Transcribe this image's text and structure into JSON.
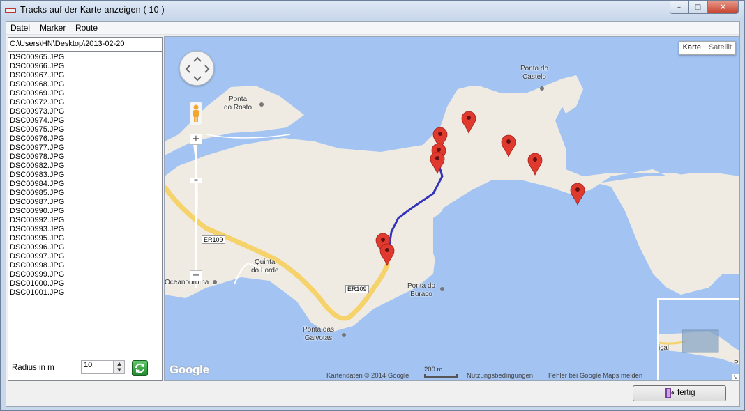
{
  "window": {
    "title": "Tracks auf der Karte anzeigen  ( 10 )",
    "controls": {
      "minimize": "–",
      "maximize": "□",
      "close": "✕"
    }
  },
  "menu": {
    "items": [
      "Datei",
      "Marker",
      "Route"
    ]
  },
  "left_panel": {
    "path": "C:\\Users\\HN\\Desktop\\2013-02-20",
    "files": [
      "DSC00965.JPG",
      "DSC00966.JPG",
      "DSC00967.JPG",
      "DSC00968.JPG",
      "DSC00969.JPG",
      "DSC00972.JPG",
      "DSC00973.JPG",
      "DSC00974.JPG",
      "DSC00975.JPG",
      "DSC00976.JPG",
      "DSC00977.JPG",
      "DSC00978.JPG",
      "DSC00982.JPG",
      "DSC00983.JPG",
      "DSC00984.JPG",
      "DSC00985.JPG",
      "DSC00987.JPG",
      "DSC00990.JPG",
      "DSC00992.JPG",
      "DSC00993.JPG",
      "DSC00995.JPG",
      "DSC00996.JPG",
      "DSC00997.JPG",
      "DSC00998.JPG",
      "DSC00999.JPG",
      "DSC01000.JPG",
      "DSC01001.JPG"
    ],
    "radius_label": "Radius in m",
    "radius_value": "10"
  },
  "map": {
    "type_buttons": {
      "map": "Karte",
      "satellite": "Satellit"
    },
    "labels": {
      "ponta_do_castelo": "Ponta do\nCastelo",
      "ponta_do_rosto": "Ponta\ndo Rosto",
      "quinta_do_lorde": "Quinta\ndo Lorde",
      "oceanodroma": "Oceanodroma",
      "ponta_do_buraco": "Ponta do\nBuraco",
      "ponta_das_gaivotas": "Ponta das\nGaivotas",
      "road1": "ER109",
      "road2": "ER109",
      "overview_text": "içal",
      "overview_p": "P"
    },
    "logo": "Google",
    "attribution": "Kartendaten © 2014 Google",
    "scale": "200 m",
    "terms": "Nutzungsbedingungen",
    "report": "Fehler bei Google Maps melden",
    "colors": {
      "water": "#a3c4f3",
      "land": "#efebe2",
      "route": "#3333bb",
      "marker": "#e03a2f",
      "road": "#f6d26b"
    }
  },
  "footer": {
    "done_label": "fertig"
  }
}
